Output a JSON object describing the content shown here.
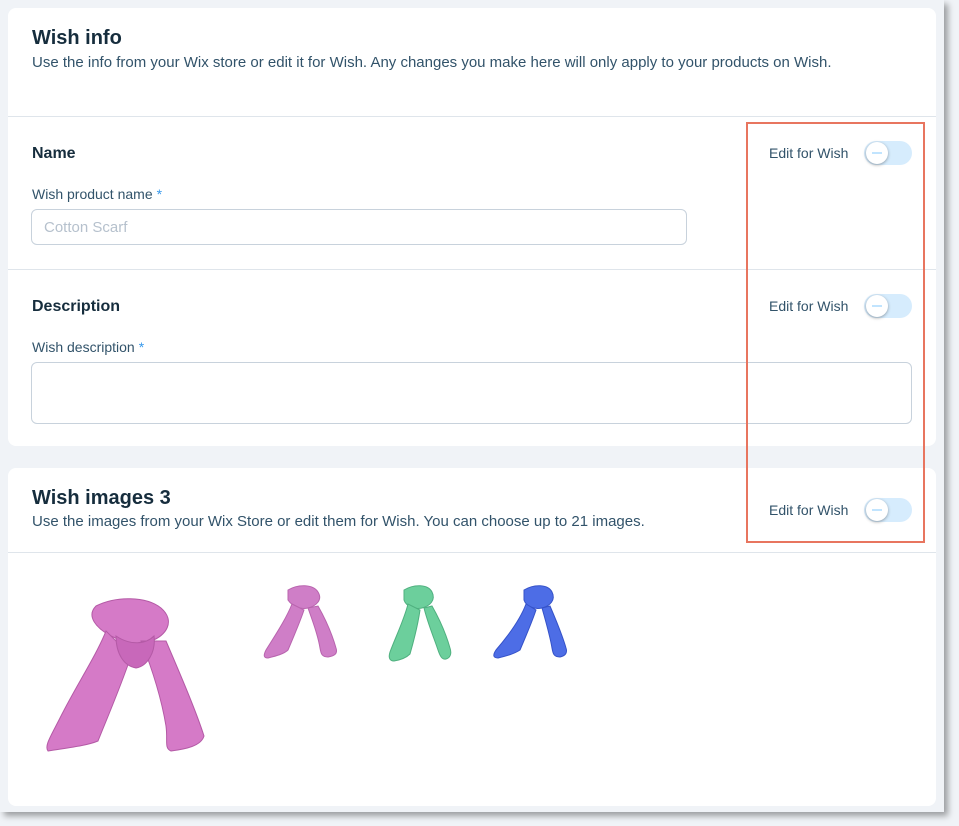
{
  "wish_info": {
    "title": "Wish info",
    "description": "Use the info from your Wix store or edit it for Wish. Any changes you make here will only apply to your products on Wish."
  },
  "name_section": {
    "heading": "Name",
    "field_label": "Wish product name",
    "required_mark": "*",
    "placeholder": "Cotton Scarf",
    "toggle_label": "Edit for Wish"
  },
  "description_section": {
    "heading": "Description",
    "field_label": "Wish description",
    "required_mark": "*",
    "value": "",
    "toggle_label": "Edit for Wish"
  },
  "wish_images": {
    "title": "Wish images 3",
    "description": "Use the images from your Wix Store or edit them for Wish. You can choose up to 21 images.",
    "toggle_label": "Edit for Wish",
    "images": [
      {
        "name": "pink scarf main",
        "color": "#d57ac7"
      },
      {
        "name": "pink scarf",
        "color": "#cf7ec7"
      },
      {
        "name": "green scarf",
        "color": "#6ccf9c"
      },
      {
        "name": "blue scarf",
        "color": "#4d6de6"
      }
    ]
  },
  "colors": {
    "highlight": "#e8755f",
    "toggle_track": "#d6ecfd",
    "required": "#3899ec"
  }
}
